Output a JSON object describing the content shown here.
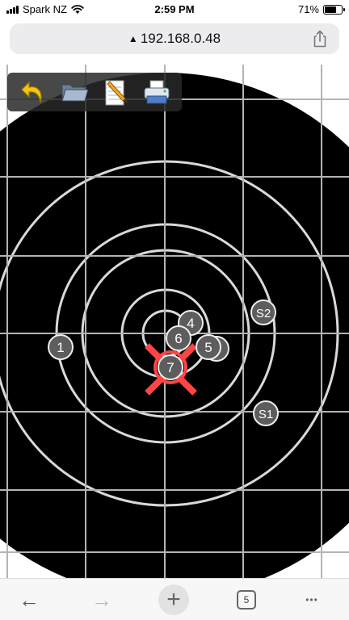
{
  "status_bar": {
    "carrier": "Spark NZ",
    "time": "2:59 PM",
    "battery": "71%",
    "battery_level": 0.71
  },
  "address_bar": {
    "url": "192.168.0.48",
    "warning_glyph": "▲"
  },
  "toolbar": {
    "tools": [
      {
        "name": "undo-icon"
      },
      {
        "name": "folder-icon"
      },
      {
        "name": "notepad-icon"
      },
      {
        "name": "printer-icon"
      }
    ]
  },
  "target": {
    "colors": {
      "black": "#000000",
      "ring": "#d9d9d9",
      "grid": "#b4b4b4",
      "shot": "#5d5d5d",
      "cross": "#ff4444"
    },
    "shots": [
      {
        "label": "1"
      },
      {
        "label": "4"
      },
      {
        "label": "6"
      },
      {
        "label": "5"
      },
      {
        "label": "7"
      },
      {
        "label": "S2"
      },
      {
        "label": "S1"
      }
    ]
  },
  "bottom_bar": {
    "tab_count": "5",
    "back": "←",
    "forward": "→",
    "new_tab": "+",
    "more": "•••"
  }
}
